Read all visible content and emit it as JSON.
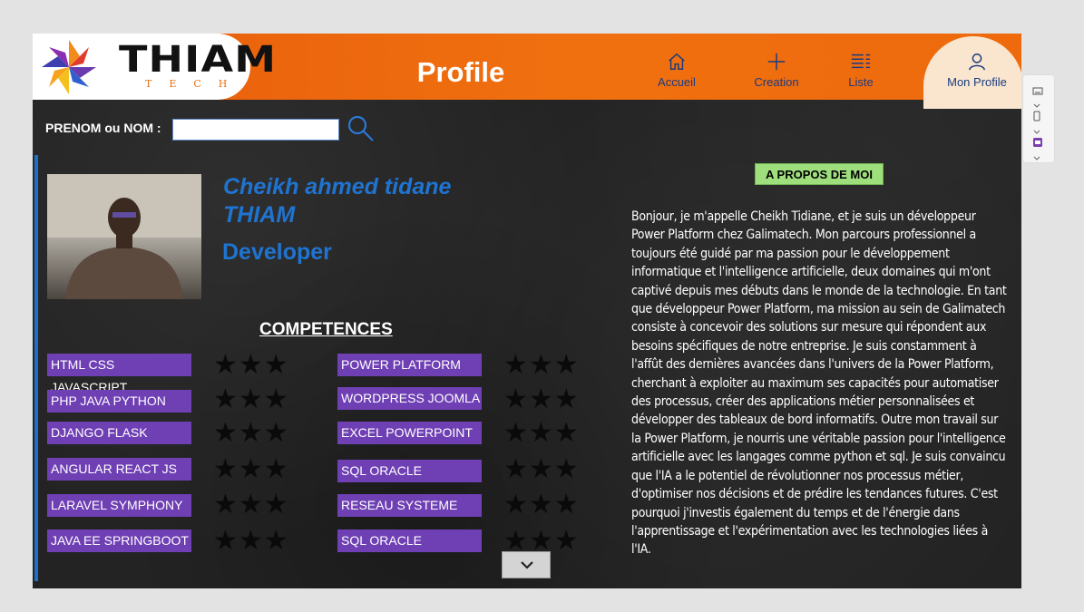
{
  "header": {
    "logo_text": "THIAM",
    "logo_subtext": "TECH",
    "title": "Profile",
    "nav": [
      {
        "label": "Accueil",
        "icon": "home-icon"
      },
      {
        "label": "Creation",
        "icon": "plus-icon"
      },
      {
        "label": "Liste",
        "icon": "list-icon"
      },
      {
        "label": "Mon Profile",
        "icon": "user-icon"
      }
    ],
    "active_nav": "Mon Profile"
  },
  "search": {
    "label": "PRENOM ou NOM :",
    "value": "",
    "icon": "search-icon"
  },
  "profile": {
    "name": "Cheikh ahmed tidane THIAM",
    "role": "Developer",
    "photo_icon": "profile-photo"
  },
  "competences": {
    "title": "COMPETENCES",
    "rating_symbol": "★★★",
    "left": [
      {
        "label": "HTML CSS JAVASCRIPT",
        "stars": 3
      },
      {
        "label": "PHP JAVA PYTHON",
        "stars": 3
      },
      {
        "label": "DJANGO FLASK",
        "stars": 3
      },
      {
        "label": "ANGULAR REACT JS",
        "stars": 3
      },
      {
        "label": "LARAVEL SYMPHONY",
        "stars": 3
      },
      {
        "label": "JAVA EE SPRINGBOOT",
        "stars": 3
      }
    ],
    "right": [
      {
        "label": "POWER PLATFORM",
        "stars": 3
      },
      {
        "label": "WORDPRESS JOOMLA",
        "stars": 3
      },
      {
        "label": "EXCEL POWERPOINT",
        "stars": 3
      },
      {
        "label": "SQL ORACLE",
        "stars": 3
      },
      {
        "label": "RESEAU SYSTEME",
        "stars": 3
      },
      {
        "label": "SQL ORACLE",
        "stars": 3
      }
    ]
  },
  "about": {
    "title": "A PROPOS DE MOI",
    "text": "Bonjour, je m'appelle Cheikh Tidiane, et je suis un développeur Power Platform chez Galimatech. Mon parcours professionnel a toujours été guidé par ma passion pour le développement informatique et l'intelligence artificielle, deux domaines qui m'ont captivé depuis mes débuts dans le monde de la technologie. En tant que développeur Power Platform, ma mission au sein de Galimatech consiste à concevoir des solutions sur mesure qui répondent aux besoins spécifiques de notre entreprise. Je suis constamment à l'affût des dernières avancées dans l'univers de la Power Platform, cherchant à exploiter au maximum ses capacités pour automatiser des processus, créer des applications métier personnalisées et développer des tableaux de bord informatifs. Outre mon travail sur la Power Platform, je nourris une véritable passion pour l'intelligence artificielle avec les langages comme python et sql. Je suis convaincu que l'IA a le potentiel de révolutionner nos processus métier, d'optimiser nos décisions et de prédire les tendances futures. C'est pourquoi j'investis également du temps et de l'énergie dans l'apprentissage et l'expérimentation avec les technologies liées à l'IA."
  },
  "colors": {
    "header_orange": "#ee6a0d",
    "accent_blue": "#1f74d1",
    "skill_purple": "#6f3fb4",
    "about_green": "#9ede7d"
  }
}
